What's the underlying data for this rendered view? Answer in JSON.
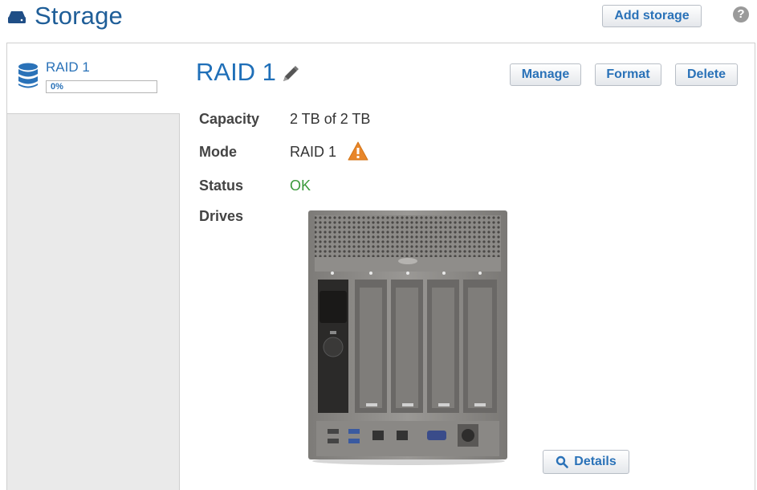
{
  "header": {
    "title": "Storage",
    "add_storage_label": "Add storage",
    "help_label": "?"
  },
  "sidebar": {
    "items": [
      {
        "name": "RAID 1",
        "usage_text": "0%",
        "usage_fraction": 0.0
      }
    ]
  },
  "detail": {
    "title": "RAID 1",
    "actions": {
      "manage": "Manage",
      "format": "Format",
      "delete": "Delete"
    },
    "fields": {
      "capacity_label": "Capacity",
      "capacity_value": "2 TB of 2 TB",
      "mode_label": "Mode",
      "mode_value": "RAID 1",
      "status_label": "Status",
      "status_value": "OK",
      "drives_label": "Drives"
    },
    "details_label": "Details"
  },
  "colors": {
    "accent": "#1f6fb8",
    "status_ok": "#3a9a3a",
    "warning": "#e8862a"
  },
  "icons": [
    "storage-drive-icon",
    "help-icon",
    "database-icon",
    "pencil-icon",
    "warning-icon",
    "magnifier-icon"
  ]
}
